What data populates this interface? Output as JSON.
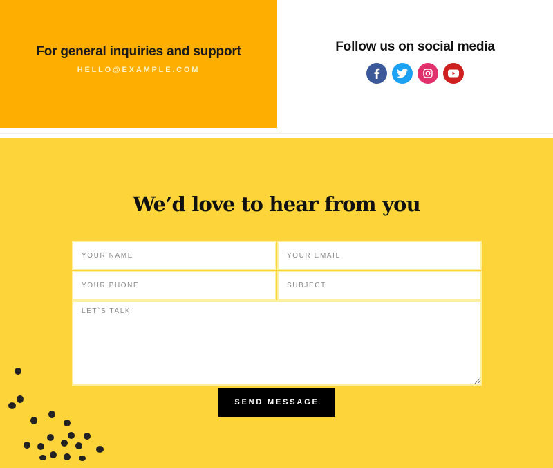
{
  "inquiry": {
    "title": "For general inquiries and support",
    "email": "HELLO@EXAMPLE.COM",
    "background": "#fdae00"
  },
  "social": {
    "title": "Follow us on social media",
    "icons": [
      {
        "name": "facebook-icon",
        "color": "#3b5998"
      },
      {
        "name": "twitter-icon",
        "color": "#1da1f2"
      },
      {
        "name": "instagram-icon",
        "color": "#e1306c"
      },
      {
        "name": "youtube-icon",
        "color": "#cd201f"
      }
    ]
  },
  "contact": {
    "heading": "We’d love to hear from you",
    "background": "#fdd43a",
    "fields": {
      "name_placeholder": "YOUR NAME",
      "email_placeholder": "YOUR EMAIL",
      "phone_placeholder": "YOUR PHONE",
      "subject_placeholder": "SUBJECT",
      "message_placeholder": "LET`S TALK"
    },
    "submit_label": "SEND MESSAGE"
  }
}
